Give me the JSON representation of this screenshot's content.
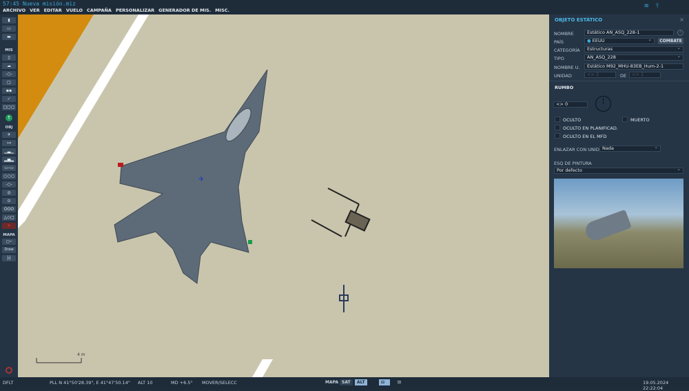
{
  "title": "57:45  Nueva misión.miz",
  "menu": [
    "ARCHIVO",
    "VER",
    "EDITAR",
    "VUELO",
    "CAMPAÑA",
    "PERSONALIZAR",
    "GENERADOR DE MIS.",
    "MISC."
  ],
  "toolbar": {
    "mis_label": "MIS",
    "obj_label": "OBJ",
    "mapa_label": "MAPA",
    "draw_label": "Draw"
  },
  "map": {
    "scale_label": "4 m"
  },
  "panel": {
    "title": "OBJETO ESTÁTICO",
    "nombre_label": "NOMBRE",
    "nombre_value": "Estático AN_ASQ_228-1",
    "pais_label": "PAÍS",
    "pais_value": "EEUU",
    "combate_label": "COMBATE",
    "categoria_label": "CATEGORÍA",
    "categoria_value": "Estructuras",
    "tipo_label": "TIPO",
    "tipo_value": "AN_ASQ_228",
    "nombreu_label": "NOMBRE U.",
    "nombreu_value": "Estático M92_MHU-83EB_Hum-2-1",
    "unidad_label": "UNIDAD",
    "unidad_value": "<> 1",
    "de_label": "DE",
    "de_value": "<> 1",
    "rumbo_label": "RUMBO",
    "rumbo_value": "<> 0",
    "oculto": "OCULTO",
    "muerto": "MUERTO",
    "oculto_plan": "OCULTO EN PLANIFICAD.",
    "oculto_mfd": "OCULTO EN EL MFD",
    "enlazar_label": "ENLAZAR CON UNID.",
    "enlazar_value": "Nada",
    "pintura_label": "ESQ DE PINTURA",
    "pintura_value": "Por defecto"
  },
  "status": {
    "mode": "DFLT",
    "pll": "PLL  N 41°50'28.39\", E 41°47'50.14\"",
    "alt": "ALT   10",
    "md": "MD   +6.5°",
    "action": "MOVER/SELECC",
    "mapa": "MAPA",
    "sat": "SAT",
    "alt_btn": "ALT",
    "datetime": "19.05.2024 22:22:04"
  },
  "colors": {
    "accent": "#3aa7d8",
    "map": "#c9c5ad",
    "panel": "#253546"
  }
}
